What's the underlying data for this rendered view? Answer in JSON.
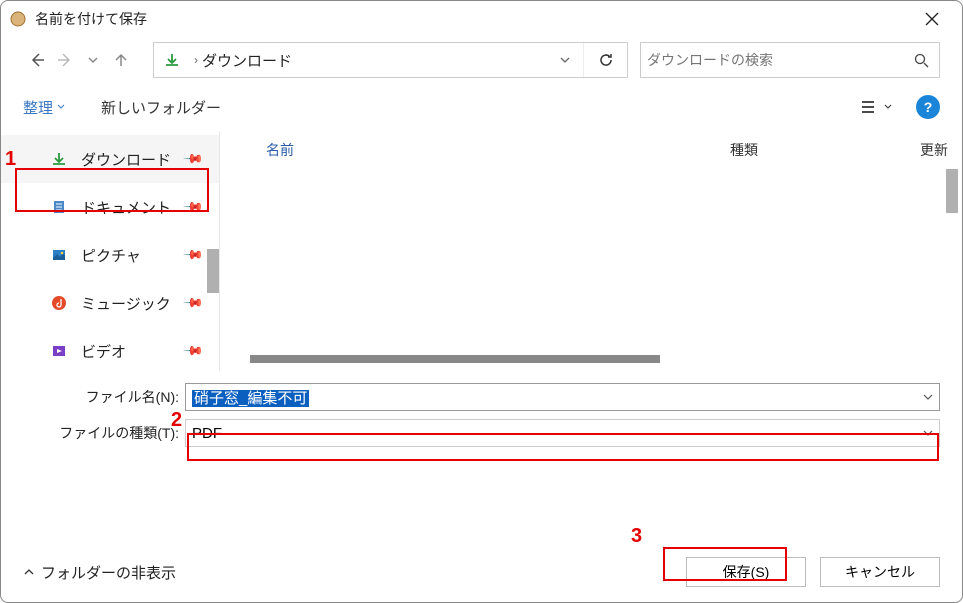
{
  "window": {
    "title": "名前を付けて保存"
  },
  "path": {
    "location": "ダウンロード"
  },
  "search": {
    "placeholder": "ダウンロードの検索"
  },
  "toolbar": {
    "organize": "整理",
    "new_folder": "新しいフォルダー"
  },
  "sidebar": {
    "items": [
      {
        "label": "ダウンロード"
      },
      {
        "label": "ドキュメント"
      },
      {
        "label": "ピクチャ"
      },
      {
        "label": "ミュージック"
      },
      {
        "label": "ビデオ"
      }
    ]
  },
  "columns": {
    "name": "名前",
    "type": "種類",
    "modified": "更新"
  },
  "form": {
    "filename_label": "ファイル名(N):",
    "filename_value": "硝子窓_編集不可",
    "filetype_label": "ファイルの種類(T):",
    "filetype_value": "PDF"
  },
  "footer": {
    "hide_folders": "フォルダーの非表示",
    "save": "保存(S)",
    "cancel": "キャンセル"
  },
  "annotations": {
    "a1": "1",
    "a2": "2",
    "a3": "3"
  },
  "help": {
    "label": "?"
  }
}
